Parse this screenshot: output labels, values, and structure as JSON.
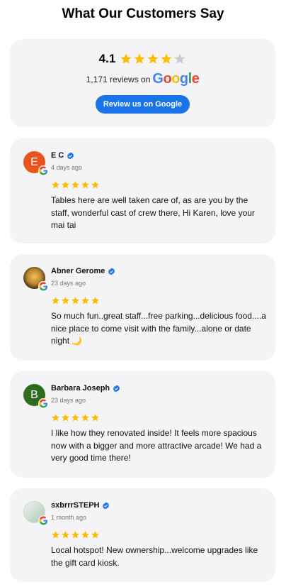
{
  "heading": "What Our Customers Say",
  "summary": {
    "rating": "4.1",
    "rating_value": 4.1,
    "reviews_text": "1,171 reviews on",
    "google_logo": "Google",
    "button_label": "Review us on Google"
  },
  "colors": {
    "star": "#fbbc04",
    "star_empty": "#cccccc",
    "button": "#1a73e8",
    "verified": "#1a73e8",
    "card_bg": "#f4f4f6"
  },
  "reviews": [
    {
      "name": "E C",
      "initial": "E",
      "avatar_color": "#e8541c",
      "date": "4 days ago",
      "stars": 5,
      "text": "Tables here are well taken care of, as are you by the staff, wonderful cast of crew there, Hi Karen, love your mai tai"
    },
    {
      "name": "Abner Gerome",
      "initial": "",
      "avatar_color": "#8a6a2a",
      "date": "23 days ago",
      "stars": 5,
      "text": "So much fun..great staff...free parking...delicious food....a nice place to come visit with the family...alone or date night 🌙"
    },
    {
      "name": "Barbara Joseph",
      "initial": "B",
      "avatar_color": "#2e6b1f",
      "date": "23 days ago",
      "stars": 5,
      "text": "I like how they renovated inside! It feels more spacious now with a bigger and more attractive arcade! We had a very good time there!"
    },
    {
      "name": "sxbrrrSTEPH",
      "initial": "",
      "avatar_color": "#d9e4dc",
      "date": "1 month ago",
      "stars": 5,
      "text": "Local hotspot! New ownership...welcome upgrades like the gift card kiosk."
    }
  ]
}
